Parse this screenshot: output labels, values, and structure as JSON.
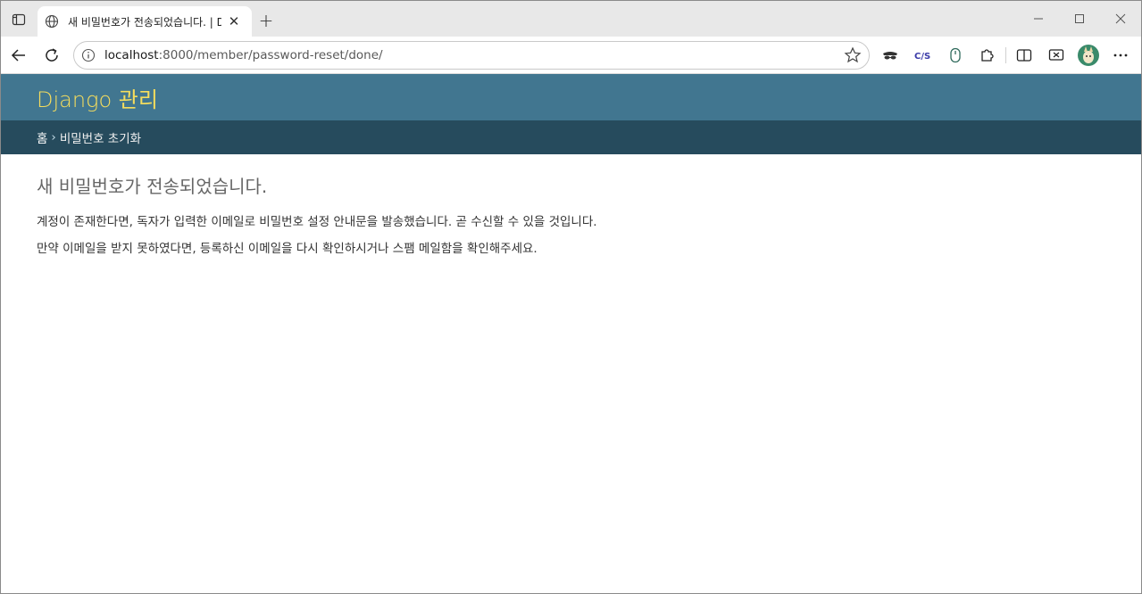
{
  "browser": {
    "tab_title": "새 비밀번호가 전송되었습니다. | Django 사이트 관리",
    "url_host": "localhost",
    "url_path": ":8000/member/password-reset/done/",
    "new_tab_glyph": "+",
    "close_glyph": "✕"
  },
  "page": {
    "site_name": "Django 관리",
    "breadcrumbs": {
      "home": "홈",
      "separator": "›",
      "current": "비밀번호 초기화"
    },
    "title": "새 비밀번호가 전송되었습니다.",
    "paragraphs": [
      "계정이 존재한다면, 독자가 입력한 이메일로 비밀번호 설정 안내문을 발송했습니다. 곧 수신할 수 있을 것입니다.",
      "만약 이메일을 받지 못하였다면, 등록하신 이메일을 다시 확인하시거나 스팸 메일함을 확인해주세요."
    ]
  },
  "icons": {
    "tab_actions": "tab-actions-icon",
    "favicon": "globe-icon",
    "back": "back-arrow-icon",
    "reload": "reload-icon",
    "site_info": "info-icon",
    "favorite": "star-icon",
    "extensions": [
      "incognito-mask-icon",
      "cjs-icon",
      "mouse-icon",
      "puzzle-icon",
      "split-screen-icon",
      "screenshot-icon",
      "profile-avatar",
      "more-icon"
    ]
  },
  "colors": {
    "header_bg": "#417690",
    "breadcrumb_bg": "#264b5d",
    "site_name": "#f5dd5d"
  }
}
